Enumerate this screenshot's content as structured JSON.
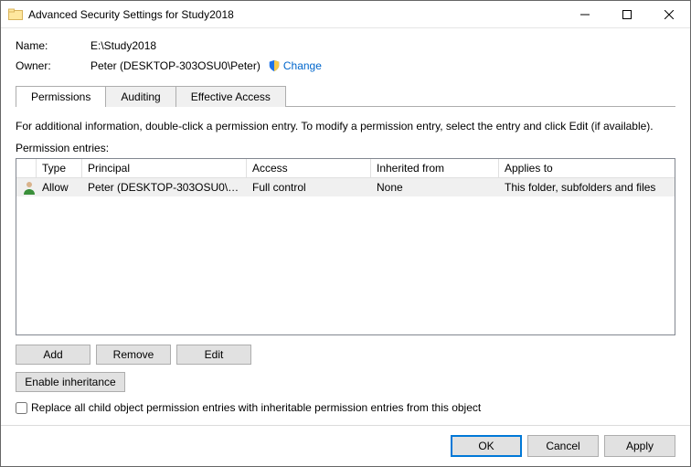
{
  "window": {
    "title": "Advanced Security Settings for Study2018"
  },
  "labels": {
    "name": "Name:",
    "owner": "Owner:",
    "change": "Change",
    "permission_entries": "Permission entries:",
    "description": "For additional information, double-click a permission entry. To modify a permission entry, select the entry and click Edit (if available).",
    "replace_checkbox": "Replace all child object permission entries with inheritable permission entries from this object"
  },
  "values": {
    "name": "E:\\Study2018",
    "owner": "Peter (DESKTOP-303OSU0\\Peter)"
  },
  "tabs": {
    "permissions": "Permissions",
    "auditing": "Auditing",
    "effective": "Effective Access"
  },
  "table": {
    "headers": {
      "type": "Type",
      "principal": "Principal",
      "access": "Access",
      "inherited": "Inherited from",
      "applies": "Applies to"
    },
    "rows": [
      {
        "type": "Allow",
        "principal": "Peter (DESKTOP-303OSU0\\Pet...",
        "access": "Full control",
        "inherited": "None",
        "applies": "This folder, subfolders and files"
      }
    ]
  },
  "buttons": {
    "add": "Add",
    "remove": "Remove",
    "edit": "Edit",
    "enable_inh": "Enable inheritance",
    "ok": "OK",
    "cancel": "Cancel",
    "apply": "Apply"
  }
}
